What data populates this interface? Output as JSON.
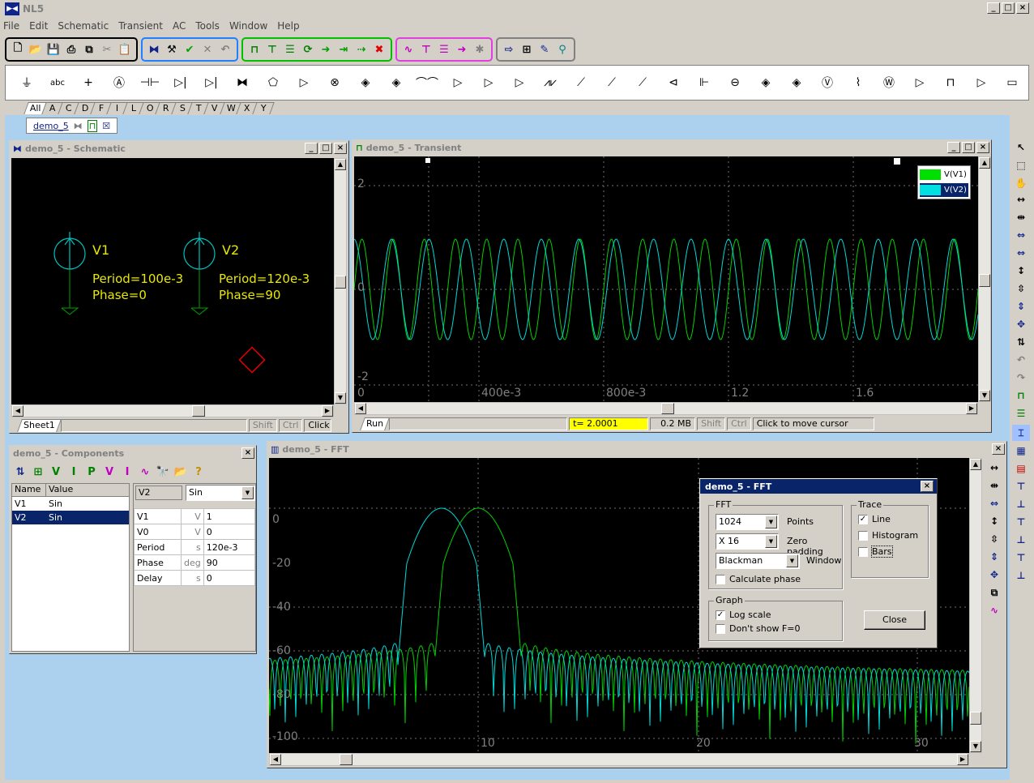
{
  "app": {
    "title": "NL5",
    "window_buttons": [
      "_",
      "□",
      "×"
    ]
  },
  "menu": [
    "File",
    "Edit",
    "Schematic",
    "Transient",
    "AC",
    "Tools",
    "Window",
    "Help"
  ],
  "component_tabs": [
    "All",
    "A",
    "C",
    "D",
    "F",
    "I",
    "L",
    "O",
    "R",
    "S",
    "T",
    "V",
    "W",
    "X",
    "Y"
  ],
  "doc_tab": {
    "label": "demo_5"
  },
  "schematic": {
    "title": "demo_5 - Schematic",
    "sources": [
      {
        "name": "V1",
        "param1": "Period=100e-3",
        "param2": "Phase=0"
      },
      {
        "name": "V2",
        "param1": "Period=120e-3",
        "param2": "Phase=90"
      }
    ],
    "sheet_tab": "Sheet1",
    "status": {
      "shift": "Shift",
      "ctrl": "Ctrl",
      "hint": "Click t"
    }
  },
  "transient": {
    "title": "demo_5 - Transient",
    "y_labels": [
      "2",
      "0",
      "-2"
    ],
    "x_labels": [
      "0",
      "400e-3",
      "800e-3",
      "1.2",
      "1.6"
    ],
    "legend": [
      {
        "label": "V(V1)",
        "color": "#00e000"
      },
      {
        "label": "V(V2)",
        "color": "#00e0e0"
      }
    ],
    "run_tab": "Run",
    "status": {
      "time": "t= 2.0001",
      "mem": "0.2 MB",
      "shift": "Shift",
      "ctrl": "Ctrl",
      "hint": "Click to move cursor"
    }
  },
  "components": {
    "title": "demo_5 - Components",
    "headers": [
      "Name",
      "Value"
    ],
    "rows": [
      {
        "name": "V1",
        "value": "Sin"
      },
      {
        "name": "V2",
        "value": "Sin"
      }
    ],
    "selected_name": "V2",
    "selected_type": "Sin",
    "params": [
      {
        "name": "V1",
        "unit": "V",
        "value": "1"
      },
      {
        "name": "V0",
        "unit": "V",
        "value": "0"
      },
      {
        "name": "Period",
        "unit": "s",
        "value": "120e-3"
      },
      {
        "name": "Phase",
        "unit": "deg",
        "value": "90"
      },
      {
        "name": "Delay",
        "unit": "s",
        "value": "0"
      }
    ]
  },
  "fft": {
    "title": "demo_5 - FFT",
    "y_labels": [
      "0",
      "-20",
      "-40",
      "-60",
      "-80",
      "-100"
    ],
    "x_labels": [
      "10",
      "20",
      "30"
    ]
  },
  "fft_dialog": {
    "title": "demo_5 - FFT",
    "fft_group": "FFT",
    "points_value": "1024",
    "points_label": "Points",
    "zero_padding_value": "X 16",
    "zero_padding_label": "Zero padding",
    "window_value": "Blackman",
    "window_label": "Window",
    "calc_phase": "Calculate phase",
    "trace_group": "Trace",
    "line": "Line",
    "histogram": "Histogram",
    "bars": "Bars",
    "graph_group": "Graph",
    "log_scale": "Log scale",
    "dont_show_f0": "Don't show F=0",
    "close": "Close"
  }
}
